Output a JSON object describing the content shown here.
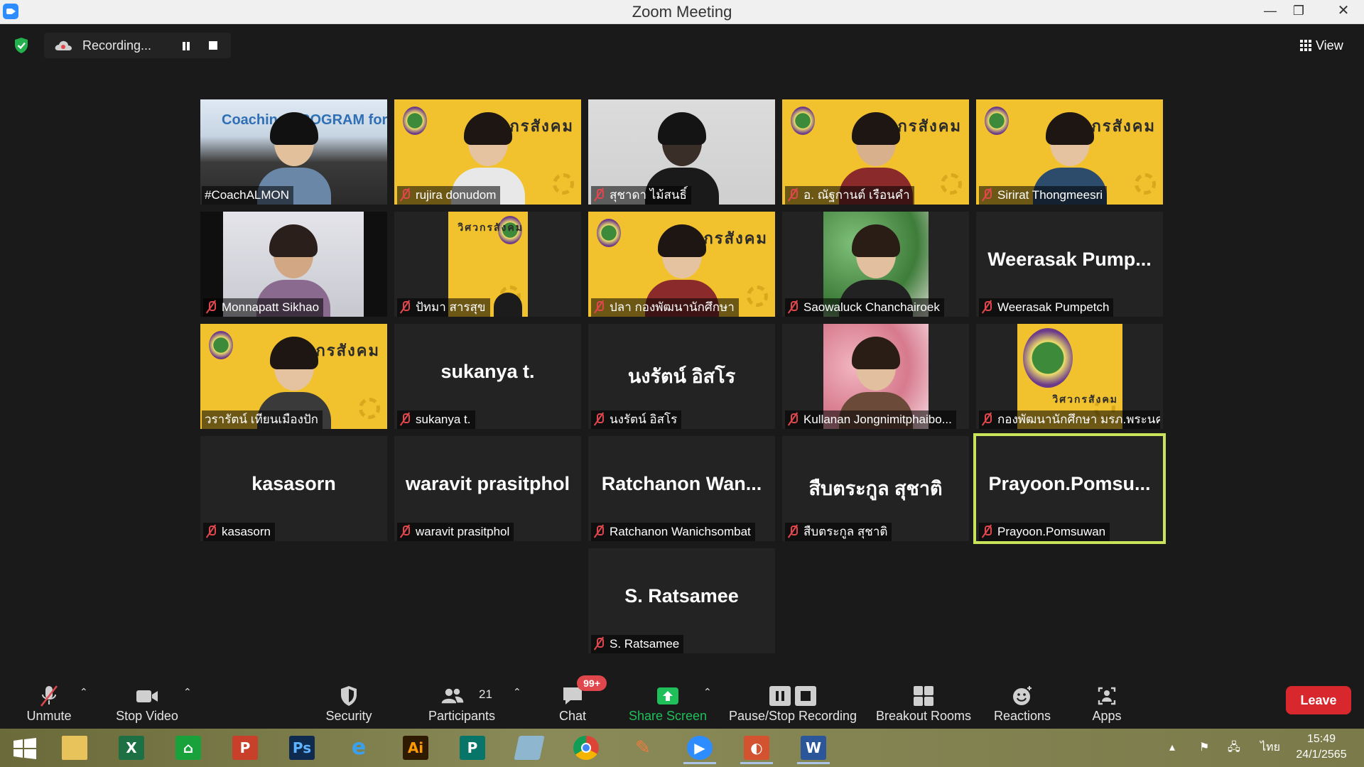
{
  "window": {
    "title": "Zoom Meeting",
    "min_glyph": "—",
    "max_glyph": "❐",
    "close_glyph": "✕"
  },
  "recording": {
    "status": "Recording..."
  },
  "view": {
    "label": "View"
  },
  "tiles": [
    {
      "name": "#CoachALMON",
      "muted": false,
      "video": "presenter",
      "banner": "Coaching PROGRAM for er"
    },
    {
      "name": "rujira donudom",
      "muted": true,
      "video": "poster-person"
    },
    {
      "name": "สุชาดา ไม้สนธิ์",
      "muted": true,
      "video": "dark-person"
    },
    {
      "name": "อ. ณัฐกานต์ เรือนคำ",
      "muted": true,
      "video": "poster-person"
    },
    {
      "name": "Sirirat Thongmeesri",
      "muted": true,
      "video": "poster-person"
    },
    {
      "name": "Monnapatt Sikhao",
      "muted": true,
      "video": "room-person"
    },
    {
      "name": "ปัทมา สารสุข",
      "muted": true,
      "video": "poster-narrow"
    },
    {
      "name": "ปลา กองพัฒนานักศึกษา",
      "muted": true,
      "video": "poster-person"
    },
    {
      "name": "Saowaluck Chanchairoek",
      "muted": true,
      "video": "photo-green"
    },
    {
      "name": "Weerasak Pumpetch",
      "muted": true,
      "video": "none",
      "big": "Weerasak  Pump..."
    },
    {
      "name": "วรารัตน์ เทียนเมืองปัก",
      "muted": false,
      "video": "poster-person"
    },
    {
      "name": "sukanya t.",
      "muted": true,
      "video": "none",
      "big": "sukanya t."
    },
    {
      "name": "นงรัตน์ อิสโร",
      "muted": true,
      "video": "none",
      "big": "นงรัตน์ อิสโร"
    },
    {
      "name": "Kullanan Jongnimitphaibo...",
      "muted": true,
      "video": "photo-pink"
    },
    {
      "name": "กองพัฒนานักศึกษา มรภ.พระนคร",
      "muted": true,
      "video": "poster-logo"
    },
    {
      "name": "kasasorn",
      "muted": true,
      "video": "none",
      "big": "kasasorn"
    },
    {
      "name": "waravit prasitphol",
      "muted": true,
      "video": "none",
      "big": "waravit prasitphol"
    },
    {
      "name": "Ratchanon Wanichsombat",
      "muted": true,
      "video": "none",
      "big": "Ratchanon  Wan..."
    },
    {
      "name": "สืบตระกูล สุชาติ",
      "muted": true,
      "video": "none",
      "big": "สืบตระกูล สุชาติ"
    },
    {
      "name": "Prayoon.Pomsuwan",
      "muted": true,
      "video": "none",
      "big": "Prayoon.Pomsu...",
      "active": true
    },
    {
      "name": "S. Ratsamee",
      "muted": true,
      "video": "none",
      "big": "S. Ratsamee"
    }
  ],
  "poster_text": "วิศวกรสังคม",
  "toolbar": {
    "unmute": "Unmute",
    "stop_video": "Stop Video",
    "security": "Security",
    "participants": "Participants",
    "participants_count": "21",
    "chat": "Chat",
    "chat_badge": "99+",
    "share_screen": "Share Screen",
    "pause_stop_recording": "Pause/Stop Recording",
    "breakout_rooms": "Breakout Rooms",
    "reactions": "Reactions",
    "apps": "Apps",
    "leave": "Leave"
  },
  "colors": {
    "share_green": "#1fbf5a",
    "leave_red": "#d9272e",
    "muted_red": "#e0474c",
    "active_border": "#c9e35a"
  },
  "taskbar": {
    "apps": [
      "windows-start",
      "file-explorer",
      "excel",
      "store",
      "powerpoint",
      "photoshop",
      "internet-explorer",
      "illustrator",
      "publisher",
      "notes",
      "chrome",
      "paint",
      "zoom",
      "powerpoint-show",
      "word"
    ],
    "ime": "ไทย",
    "time": "15:49",
    "date": "24/1/2565"
  }
}
